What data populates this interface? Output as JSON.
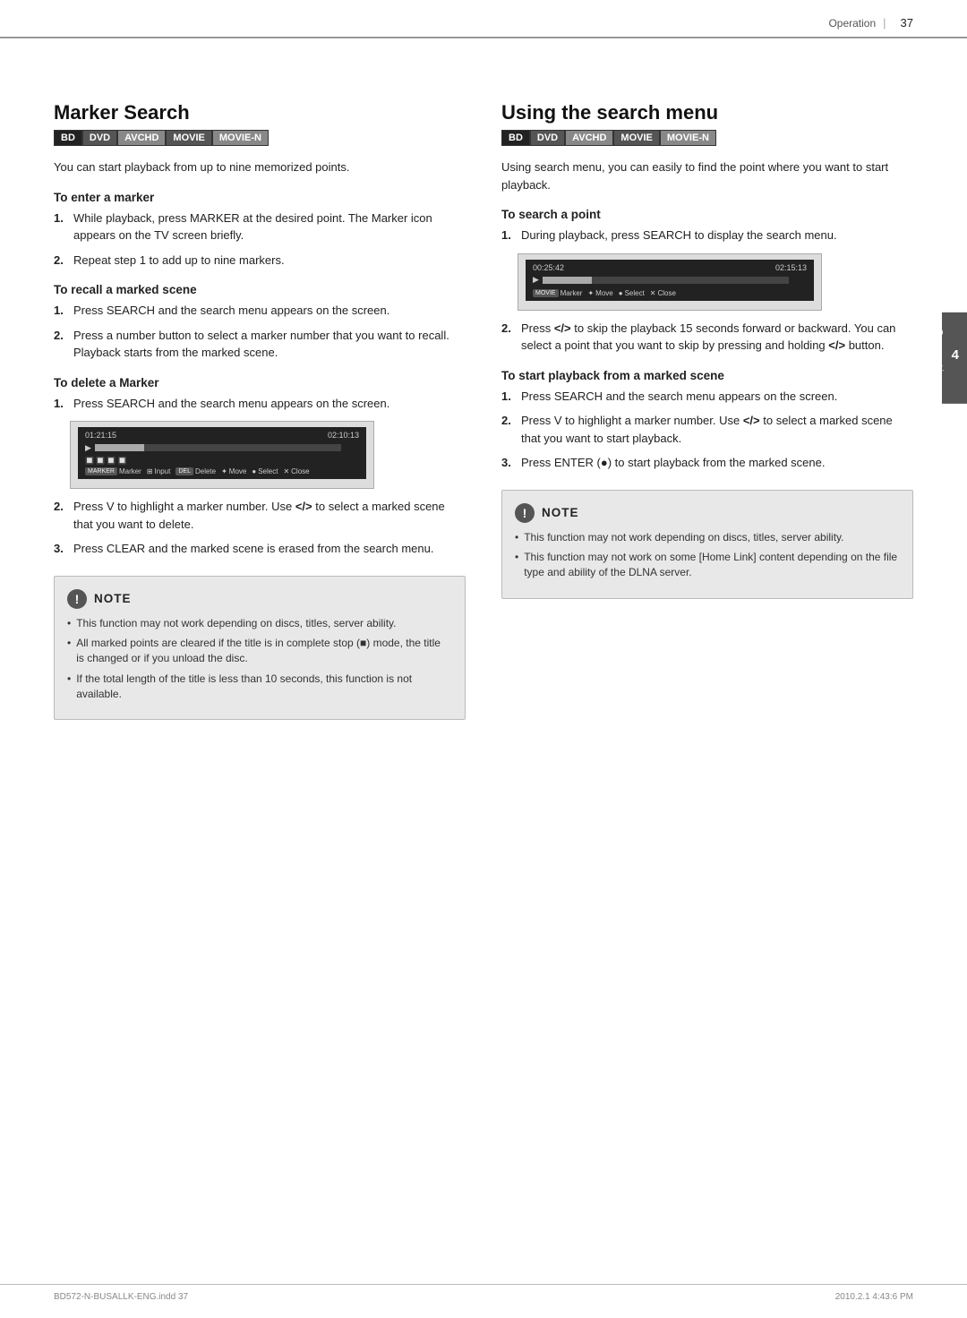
{
  "header": {
    "section": "Operation",
    "page_number": "37"
  },
  "left_section": {
    "title": "Marker Search",
    "badges": [
      "BD",
      "DVD",
      "AVCHD",
      "MOVIE",
      "MOVIE-N"
    ],
    "intro": "You can start playback from up to nine memorized points.",
    "subsections": [
      {
        "id": "enter-marker",
        "title": "To enter a marker",
        "items": [
          {
            "num": "1.",
            "text": "While playback, press MARKER at the desired point. The Marker icon appears on the TV screen briefly."
          },
          {
            "num": "2.",
            "text": "Repeat step 1 to add up to nine markers."
          }
        ]
      },
      {
        "id": "recall-marker",
        "title": "To recall a marked scene",
        "items": [
          {
            "num": "1.",
            "text": "Press SEARCH and the search menu appears on the screen."
          },
          {
            "num": "2.",
            "text": "Press a number button to select a marker number that you want to recall. Playback starts from the marked scene."
          }
        ]
      },
      {
        "id": "delete-marker",
        "title": "To delete a Marker",
        "items": [
          {
            "num": "1.",
            "text": "Press SEARCH and the search menu appears on the screen."
          }
        ],
        "has_screenshot": true,
        "screenshot": {
          "timecode_left": "01:21:15",
          "timecode_right": "02:10:13",
          "controls": [
            "MARKER",
            "Marker",
            "Input",
            "Delete",
            "Move",
            "Select",
            "Close"
          ]
        },
        "items_after": [
          {
            "num": "2.",
            "text": "Press V to highlight a marker number. Use </> to select a marked scene that you want to delete."
          },
          {
            "num": "3.",
            "text": "Press CLEAR and the marked scene is erased from the search menu."
          }
        ]
      }
    ],
    "note": {
      "title": "NOTE",
      "items": [
        "This function may not work depending on discs, titles, server ability.",
        "All marked points are cleared if the title is in complete stop (■) mode, the title is changed or if you unload the disc.",
        "If the total length of the title is less than 10 seconds, this function is not available."
      ]
    }
  },
  "right_section": {
    "title": "Using the search menu",
    "badges": [
      "BD",
      "DVD",
      "AVCHD",
      "MOVIE",
      "MOVIE-N"
    ],
    "intro": "Using search menu, you can easily to find the point where you want to start playback.",
    "subsections": [
      {
        "id": "search-point",
        "title": "To search a point",
        "items": [
          {
            "num": "1.",
            "text": "During playback, press SEARCH to display the search menu."
          }
        ],
        "has_screenshot": true,
        "screenshot": {
          "timecode_left": "00:25:42",
          "timecode_right": "02:15:13",
          "controls": [
            "MOVIE",
            "Marker",
            "Move",
            "Select",
            "Close"
          ]
        },
        "items_after": [
          {
            "num": "2.",
            "text": "Press </> to skip the playback 15 seconds forward or backward. You can select a point that you want to skip by pressing and holding </> button."
          }
        ]
      },
      {
        "id": "start-playback-marked",
        "title": "To start playback from a marked scene",
        "items": [
          {
            "num": "1.",
            "text": "Press SEARCH and the search menu appears on the screen."
          },
          {
            "num": "2.",
            "text": "Press V to highlight a marker number. Use </> to select a marked scene that you want to start playback."
          },
          {
            "num": "3.",
            "text": "Press ENTER (●) to start playback from the marked scene."
          }
        ]
      }
    ],
    "note": {
      "title": "NOTE",
      "items": [
        "This function may not work depending on discs, titles, server ability.",
        "This function may not work on some [Home Link] content depending on the file type and ability of the DLNA server."
      ]
    }
  },
  "side_tab": {
    "number": "4",
    "label": "Operation"
  },
  "footer": {
    "left": "BD572-N-BUSALLK-ENG.indd  37",
    "right": "2010.2.1  4:43:6 PM"
  }
}
